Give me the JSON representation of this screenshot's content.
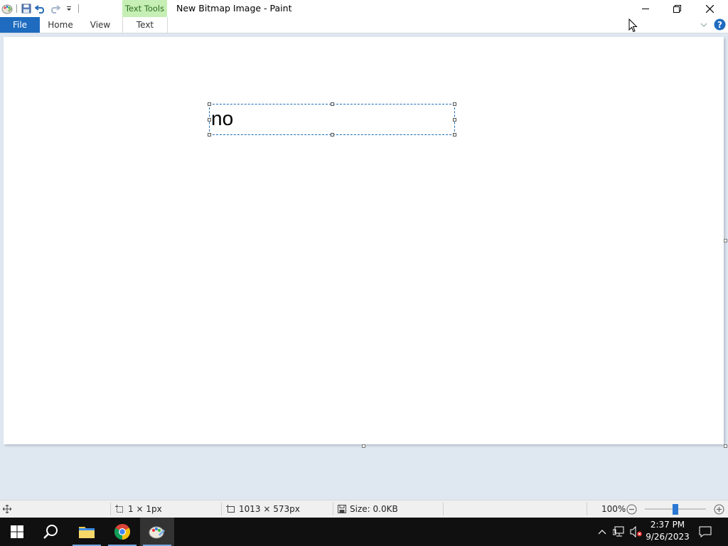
{
  "window": {
    "title": "New Bitmap Image - Paint",
    "contextual_tab_group": "Text Tools"
  },
  "ribbon_tabs": {
    "file": "File",
    "home": "Home",
    "view": "View",
    "text": "Text"
  },
  "canvas": {
    "text_content": "no"
  },
  "status_bar": {
    "selection_size": "1 × 1px",
    "image_size": "1013 × 573px",
    "file_size": "Size: 0.0KB",
    "zoom": "100%",
    "zoom_level_percent": 100
  },
  "taskbar": {
    "time": "2:37 PM",
    "date": "9/26/2023"
  },
  "colors": {
    "file_tab": "#1e6bbf",
    "text_tools_group": "#c6efb6",
    "selection_border": "#1a6db8",
    "workspace_bg": "#dfe7f1",
    "taskbar_bg": "#101010"
  },
  "icons": {
    "qat": [
      "paint-app-icon",
      "save-icon",
      "undo-icon",
      "redo-icon",
      "customize-qat-icon"
    ],
    "window_controls": [
      "minimize-icon",
      "restore-icon",
      "close-icon"
    ],
    "taskbar_apps": [
      "windows-start-icon",
      "search-icon",
      "file-explorer-icon",
      "chrome-icon",
      "paint-icon"
    ]
  }
}
